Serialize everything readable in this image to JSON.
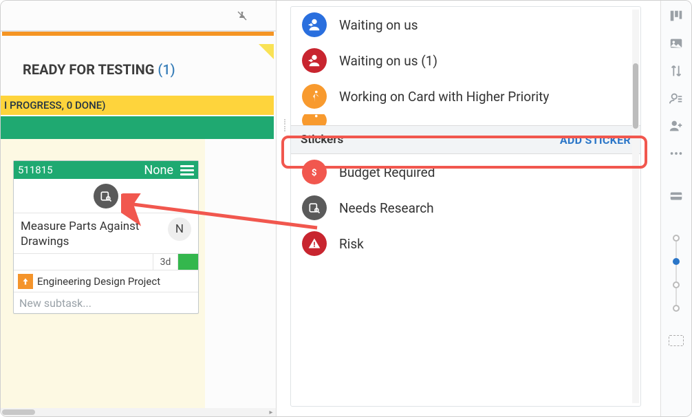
{
  "column": {
    "title": "READY FOR TESTING",
    "count_label": "(1)",
    "progress_strip": "I PROGRESS, 0 DONE)"
  },
  "card": {
    "id": "511815",
    "assignment": "None",
    "title": "Measure Parts Against Drawings",
    "avatar_initial": "N",
    "due": "3d",
    "linked_project": "Engineering Design Project",
    "new_subtask_placeholder": "New subtask..."
  },
  "panel": {
    "statuses": [
      {
        "key": "waiting_on_us",
        "label": "Waiting on us",
        "color": "blue",
        "icon": "person-back"
      },
      {
        "key": "waiting_on_us_1",
        "label": "Waiting on us (1)",
        "color": "red",
        "icon": "person-back"
      },
      {
        "key": "higher_priority",
        "label": "Working on Card with Higher Priority",
        "color": "orange",
        "icon": "runner"
      }
    ],
    "stickers_header": "Stickers",
    "add_sticker_label": "ADD STICKER",
    "stickers": [
      {
        "key": "budget",
        "label": "Budget Required",
        "color": "dollar",
        "icon": "dollar"
      },
      {
        "key": "research",
        "label": "Needs Research",
        "color": "gray",
        "icon": "research"
      },
      {
        "key": "risk",
        "label": "Risk",
        "color": "risk",
        "icon": "alert"
      }
    ]
  },
  "sidebar_icons": [
    "columns",
    "image",
    "sort",
    "contact",
    "add-user",
    "more",
    "card"
  ]
}
